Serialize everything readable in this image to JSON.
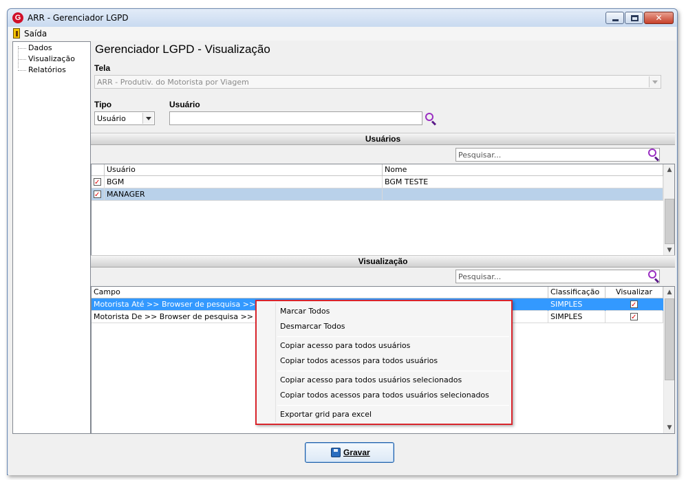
{
  "window": {
    "title": "ARR - Gerenciador LGPD",
    "icon_letter": "G"
  },
  "menu": {
    "exit_label": "Saída"
  },
  "tree": {
    "items": [
      "Dados",
      "Visualização",
      "Relatórios"
    ]
  },
  "page": {
    "title": "Gerenciador LGPD - Visualização"
  },
  "tela": {
    "label": "Tela",
    "value": "ARR - Produtiv. do Motorista por Viagem"
  },
  "tipo": {
    "label": "Tipo",
    "value": "Usuário"
  },
  "usuario": {
    "label": "Usuário",
    "value": ""
  },
  "users_section": {
    "title": "Usuários",
    "search_placeholder": "Pesquisar...",
    "columns": [
      "Usuário",
      "Nome"
    ],
    "rows": [
      {
        "checked": true,
        "usuario": "BGM",
        "nome": "BGM TESTE"
      },
      {
        "checked": true,
        "usuario": "MANAGER",
        "nome": ""
      }
    ]
  },
  "view_section": {
    "title": "Visualização",
    "search_placeholder": "Pesquisar...",
    "columns": [
      "Campo",
      "Classificação",
      "Visualizar"
    ],
    "rows": [
      {
        "campo": "Motorista Até >> Browser de pesquisa >> Nome",
        "classificacao": "SIMPLES",
        "visualizar": true
      },
      {
        "campo": "Motorista De >> Browser de pesquisa >> Nome",
        "classificacao": "SIMPLES",
        "visualizar": true
      }
    ]
  },
  "context_menu": {
    "items": [
      "Marcar Todos",
      "Desmarcar Todos",
      "Copiar acesso para todos usuários",
      "Copiar todos acessos para todos usuários",
      "Copiar acesso para todos usuários selecionados",
      "Copiar todos acessos para todos usuários selecionados",
      "Exportar grid para excel"
    ]
  },
  "footer": {
    "save_label": "Gravar"
  },
  "colors": {
    "selection": "#3399ff",
    "highlight_border": "#d9242b",
    "search_icon": "#9a2ec2"
  }
}
